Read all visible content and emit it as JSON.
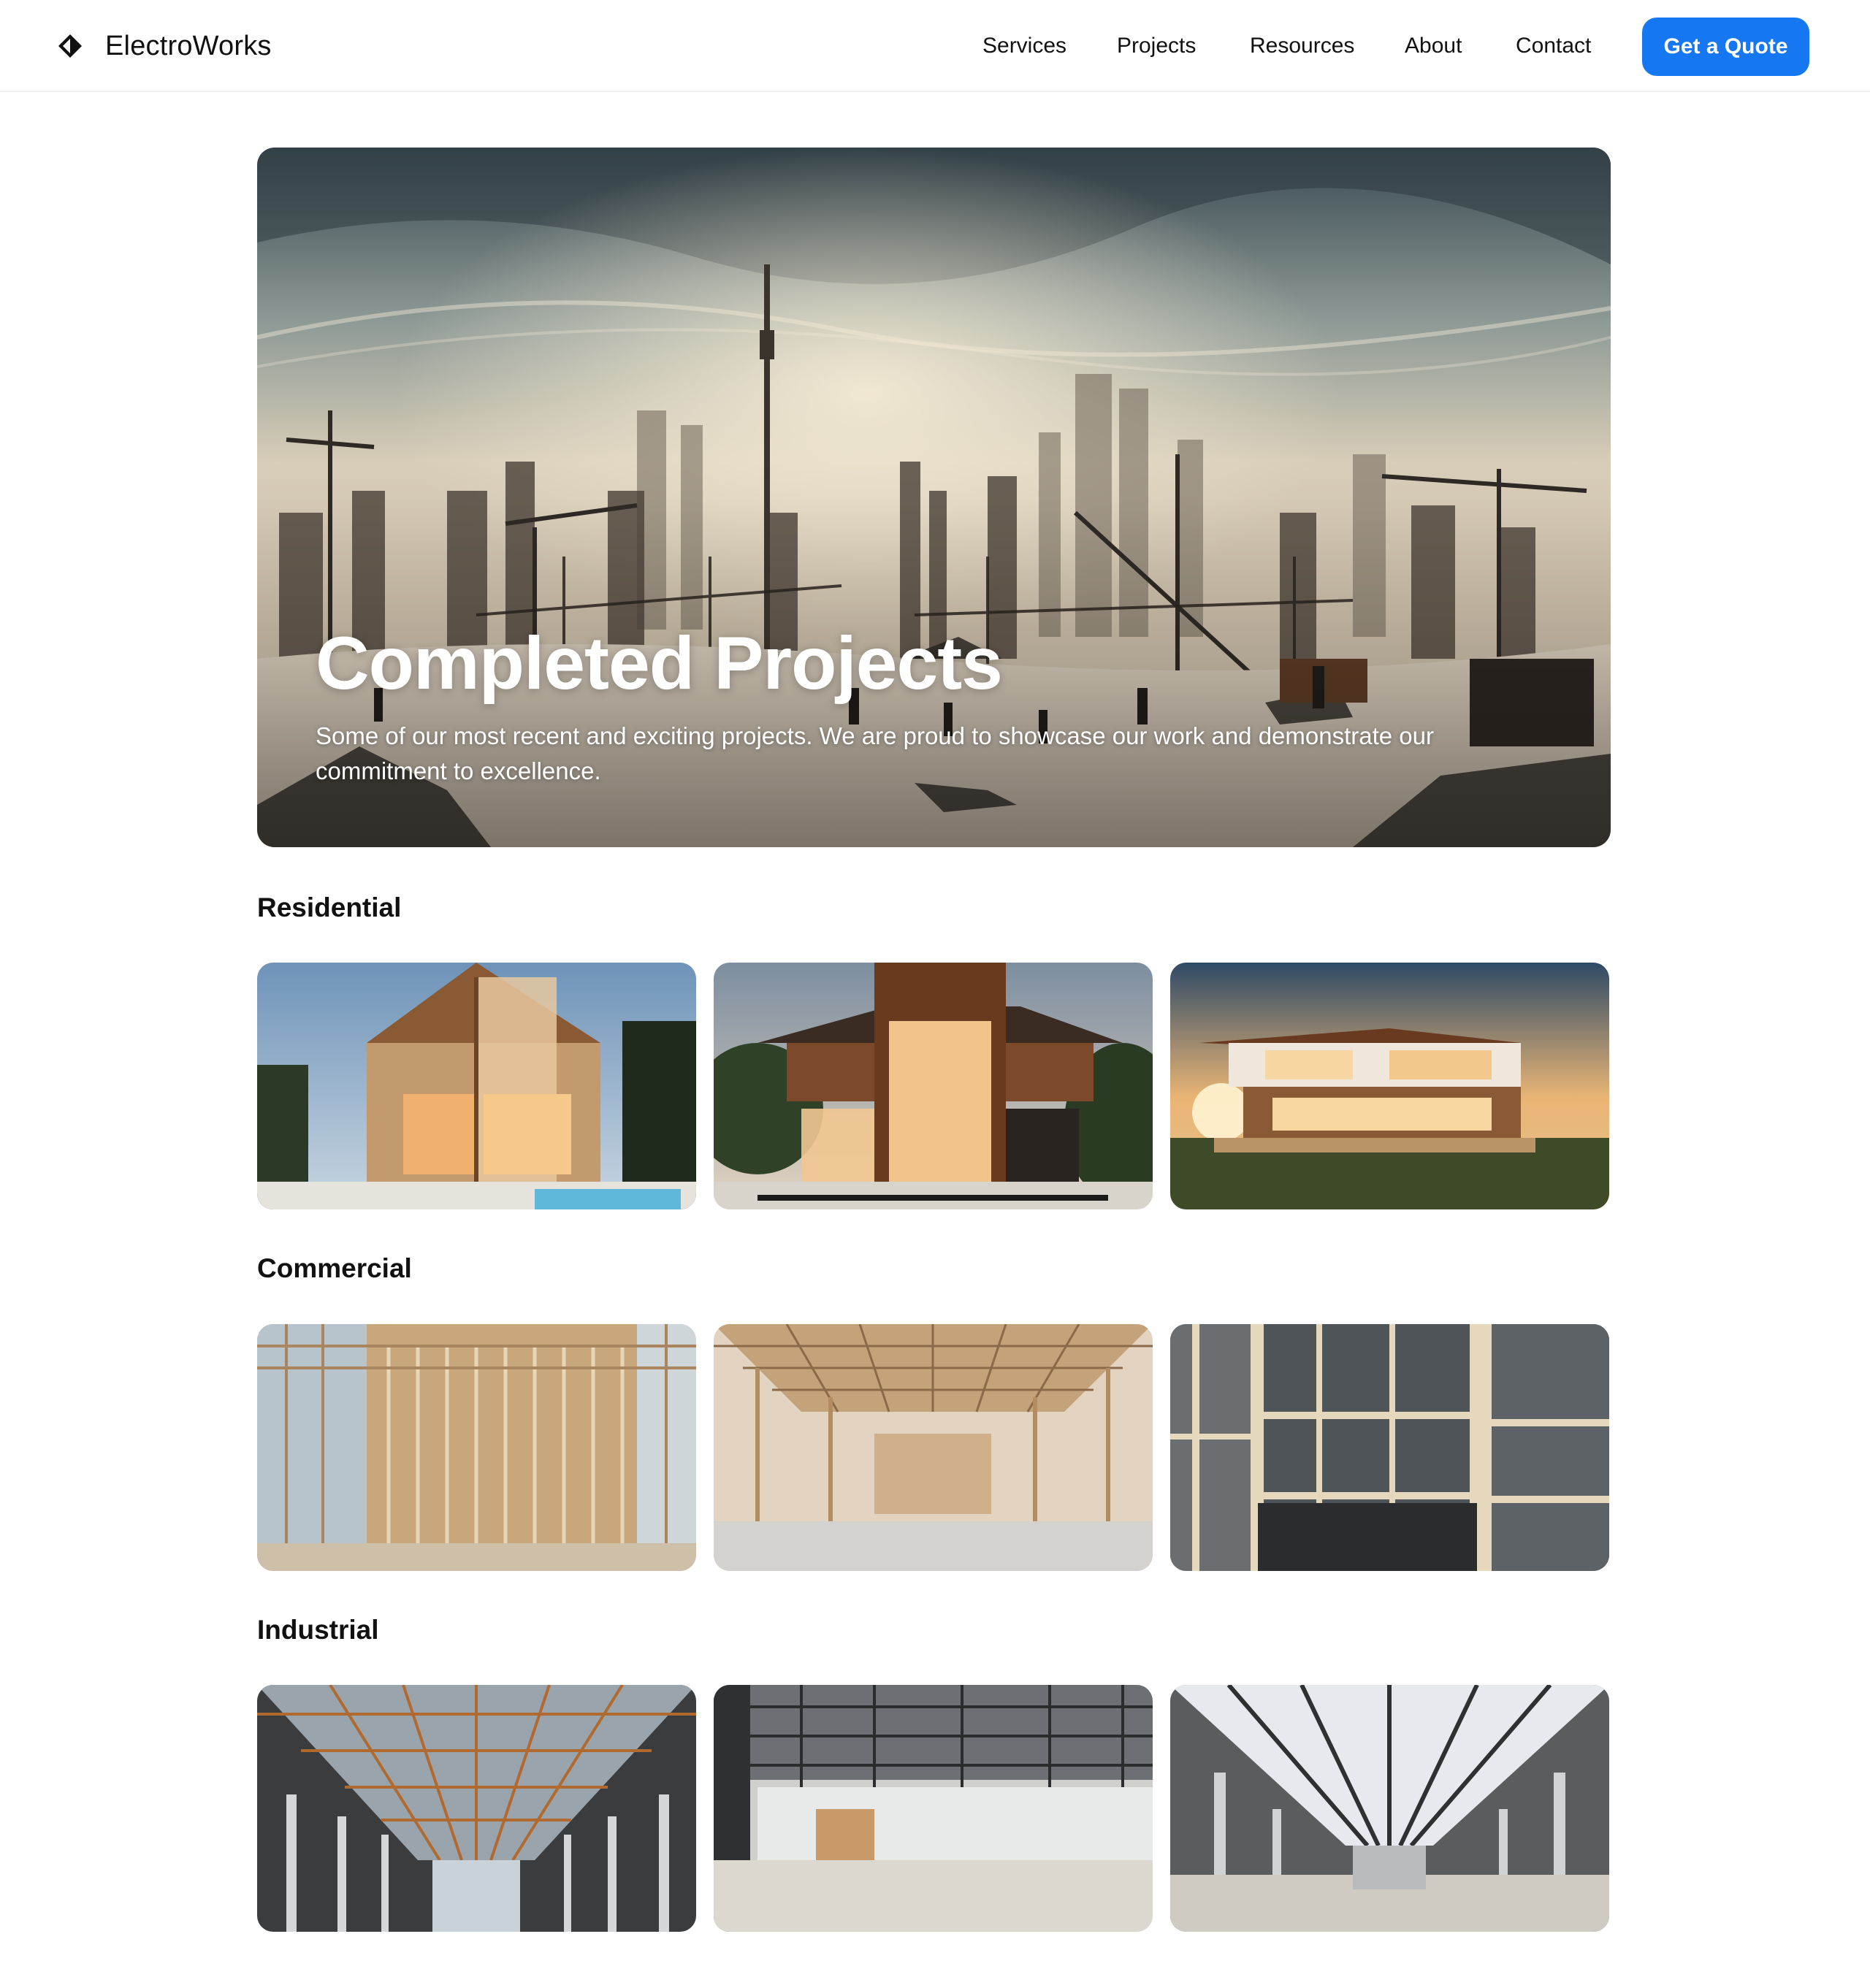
{
  "header": {
    "brand_name": "ElectroWorks",
    "nav": [
      {
        "label": "Services"
      },
      {
        "label": "Projects"
      },
      {
        "label": "Resources"
      },
      {
        "label": "About"
      },
      {
        "label": "Contact"
      }
    ],
    "cta_label": "Get a Quote",
    "accent_color": "#1677f2"
  },
  "hero": {
    "title": "Completed Projects",
    "subtitle": "Some of our most recent and exciting projects. We are proud to showcase our work and demonstrate our commitment to excellence."
  },
  "sections": [
    {
      "title": "Residential",
      "images": [
        "modern-timber-house",
        "modern-wood-villa",
        "modern-house-at-sunset"
      ]
    },
    {
      "title": "Commercial",
      "images": [
        "timber-frame-interior",
        "office-framing-interior",
        "glass-facade-framing"
      ]
    },
    {
      "title": "Industrial",
      "images": [
        "steel-roof-warehouse",
        "industrial-hall-interior",
        "factory-hall-skylights"
      ]
    }
  ]
}
